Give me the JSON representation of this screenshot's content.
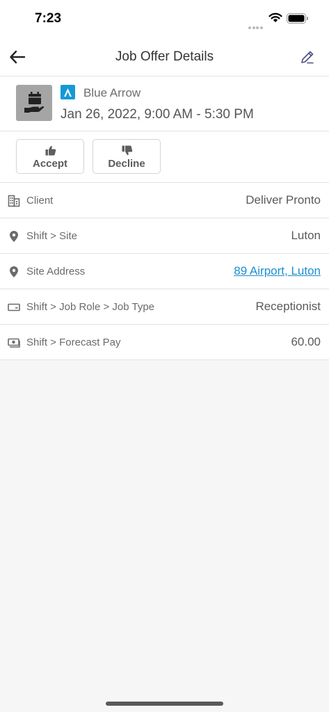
{
  "status_bar": {
    "time": "7:23"
  },
  "header": {
    "title": "Job Offer Details"
  },
  "summary": {
    "agency_name": "Blue Arrow",
    "shift_time": "Jan 26, 2022, 9:00 AM - 5:30 PM"
  },
  "actions": {
    "accept_label": "Accept",
    "decline_label": "Decline"
  },
  "details": [
    {
      "icon": "building-icon",
      "label": "Client",
      "value": "Deliver Pronto"
    },
    {
      "icon": "location-pin-icon",
      "label": "Shift > Site",
      "value": "Luton"
    },
    {
      "icon": "location-pin-icon",
      "label": "Site Address",
      "value": "89 Airport, Luton"
    },
    {
      "icon": "id-card-icon",
      "label": "Shift > Job Role > Job Type",
      "value": "Receptionist"
    },
    {
      "icon": "money-icon",
      "label": "Shift > Forecast Pay",
      "value": "60.00"
    }
  ],
  "colors": {
    "link": "#1a8fcf",
    "brand": "#1599d6",
    "background": "#f6f6f6"
  }
}
